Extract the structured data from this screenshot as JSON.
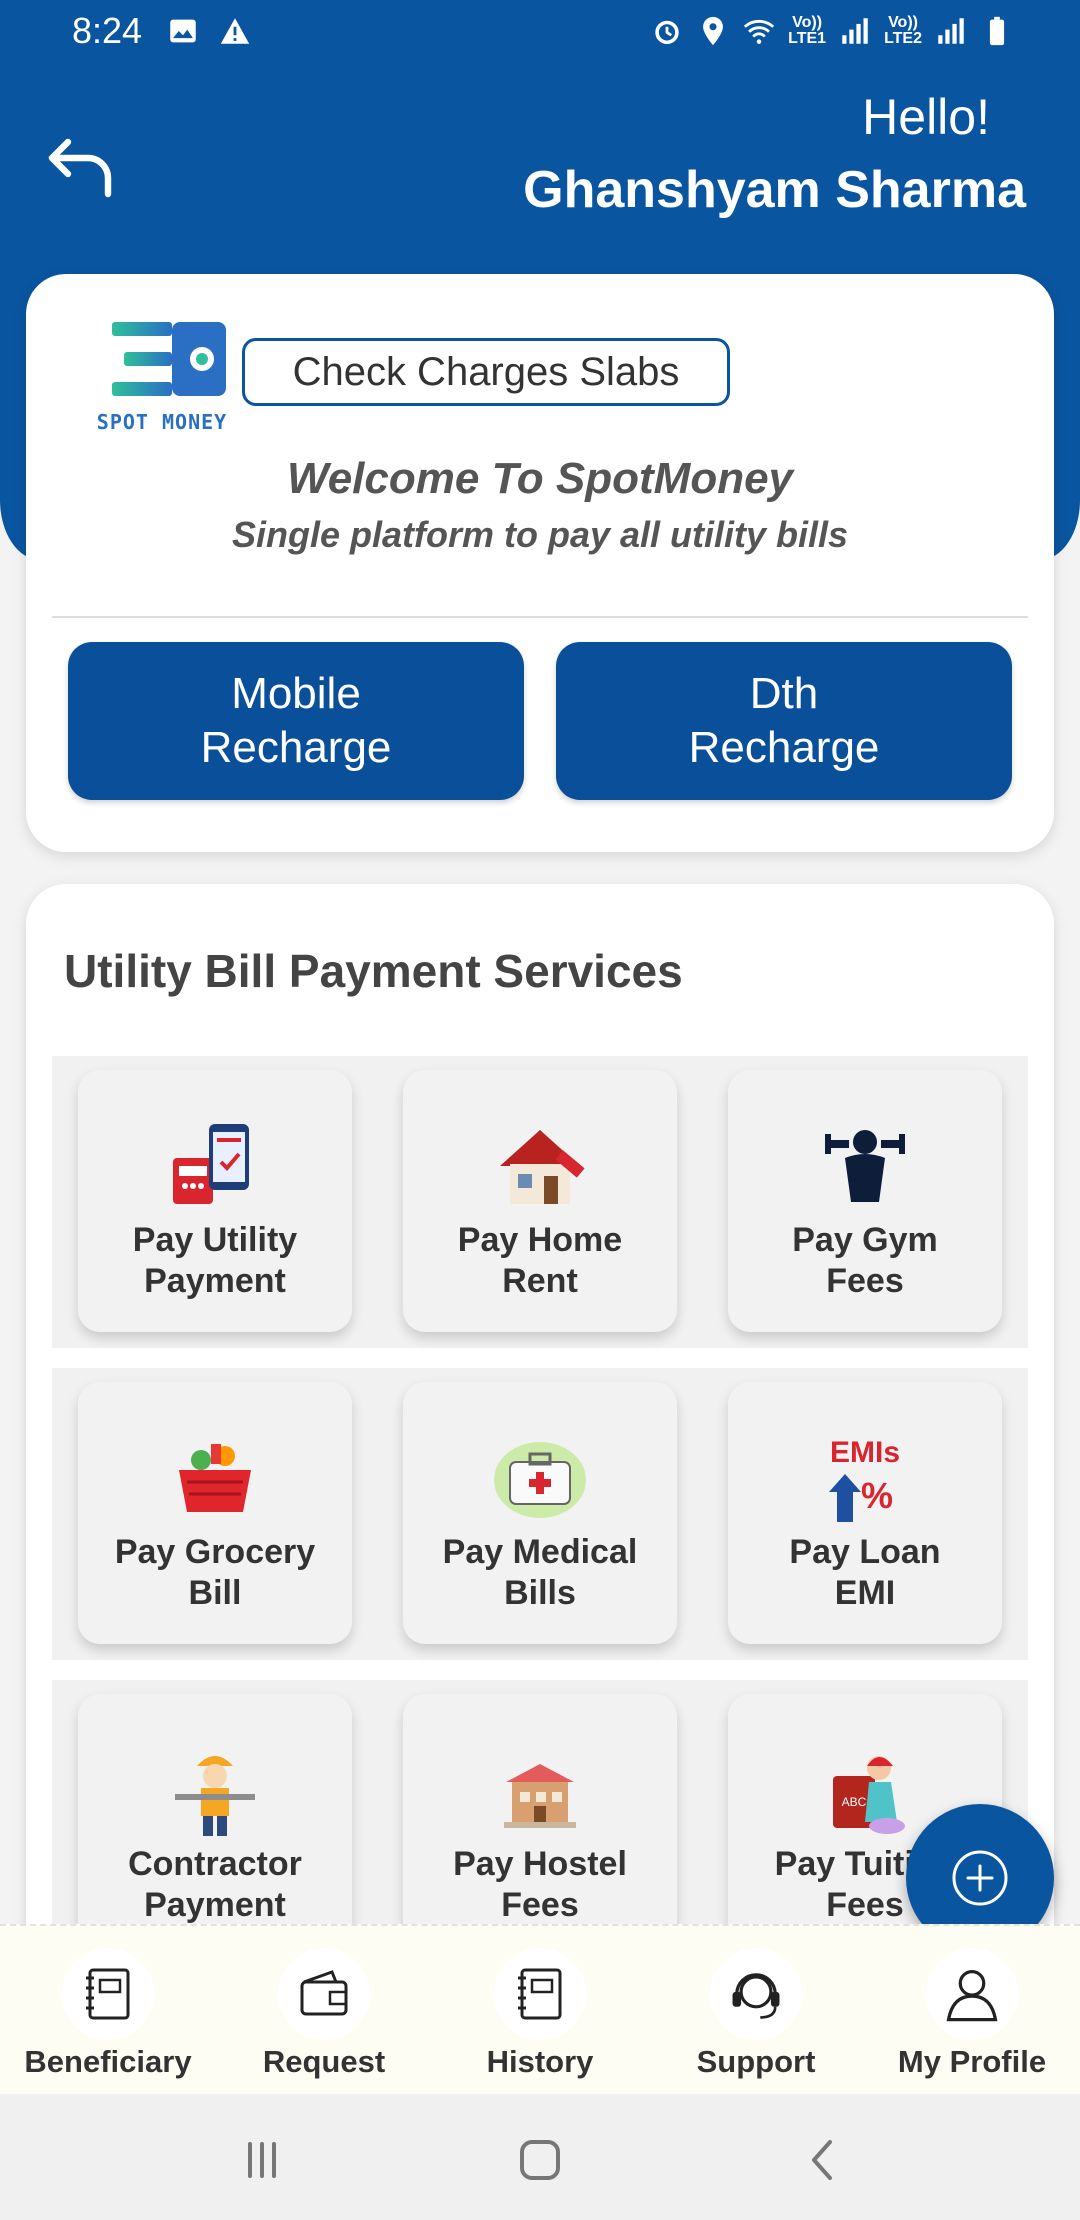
{
  "status_bar": {
    "time": "8:24",
    "net1": "Vo))\nLTE1",
    "net2": "Vo))\nLTE2",
    "icons_left": [
      "image-icon",
      "warning-icon"
    ],
    "icons_right": [
      "alarm-icon",
      "location-icon",
      "wifi-icon",
      "signal-icon",
      "signal-icon",
      "battery-icon"
    ]
  },
  "header": {
    "greeting": "Hello!",
    "user_name": "Ghanshyam Sharma"
  },
  "top_card": {
    "logo_text": "SPOT MONEY",
    "check_charges_label": "Check Charges Slabs",
    "welcome": "Welcome To SpotMoney",
    "tagline": "Single platform to pay all utility bills",
    "mobile_recharge_line1": "Mobile",
    "mobile_recharge_line2": "Recharge",
    "dth_recharge_line1": "Dth",
    "dth_recharge_line2": "Recharge"
  },
  "services": {
    "title": "Utility Bill Payment Services",
    "items": [
      {
        "line1": "Pay Utility",
        "line2": "Payment",
        "icon": "utility-phone-icon"
      },
      {
        "line1": "Pay Home",
        "line2": "Rent",
        "icon": "house-icon"
      },
      {
        "line1": "Pay Gym",
        "line2": "Fees",
        "icon": "gym-icon"
      },
      {
        "line1": "Pay Grocery",
        "line2": "Bill",
        "icon": "grocery-basket-icon"
      },
      {
        "line1": "Pay Medical",
        "line2": "Bills",
        "icon": "medical-kit-icon"
      },
      {
        "line1": "Pay Loan",
        "line2": "EMI",
        "icon": "emi-icon"
      },
      {
        "line1": "Contractor",
        "line2": "Payment",
        "icon": "contractor-icon"
      },
      {
        "line1": "Pay Hostel",
        "line2": "Fees",
        "icon": "hostel-icon"
      },
      {
        "line1": "Pay Tuition",
        "line2": "Fees",
        "icon": "tuition-book-icon"
      }
    ],
    "emi_icon_text": "EMIs"
  },
  "bottom_nav": {
    "items": [
      {
        "label": "Beneficiary",
        "icon": "notebook-icon"
      },
      {
        "label": "Request",
        "icon": "wallet-icon"
      },
      {
        "label": "History",
        "icon": "notebook-icon"
      },
      {
        "label": "Support",
        "icon": "headset-icon"
      },
      {
        "label": "My Profile",
        "icon": "user-icon"
      }
    ]
  },
  "colors": {
    "primary": "#0a55a0",
    "button": "#0a4f99",
    "nav_bg": "#fdfdf3"
  }
}
